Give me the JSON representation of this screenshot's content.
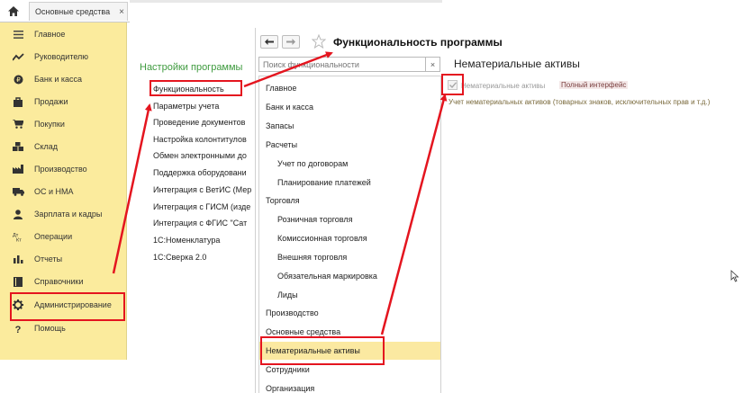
{
  "tab": {
    "title": "Основные средства",
    "close": "×"
  },
  "sidebar": {
    "items": [
      {
        "label": "Главное",
        "icon": "menu-lines-icon"
      },
      {
        "label": "Руководителю",
        "icon": "trend-icon"
      },
      {
        "label": "Банк и касса",
        "icon": "coin-icon"
      },
      {
        "label": "Продажи",
        "icon": "bag-icon"
      },
      {
        "label": "Покупки",
        "icon": "cart-icon"
      },
      {
        "label": "Склад",
        "icon": "boxes-icon"
      },
      {
        "label": "Производство",
        "icon": "factory-icon"
      },
      {
        "label": "ОС и НМА",
        "icon": "truck-icon"
      },
      {
        "label": "Зарплата и кадры",
        "icon": "person-icon"
      },
      {
        "label": "Операции",
        "icon": "dt-kt-icon"
      },
      {
        "label": "Отчеты",
        "icon": "bar-chart-icon"
      },
      {
        "label": "Справочники",
        "icon": "book-icon"
      },
      {
        "label": "Администрирование",
        "icon": "gear-icon"
      },
      {
        "label": "Помощь",
        "icon": "question-icon"
      }
    ]
  },
  "settings": {
    "title": "Настройки программы",
    "items": [
      "Функциональность",
      "Параметры учета",
      "Проведение документов",
      "Настройка колонтитулов",
      "Обмен электронными до",
      "Поддержка оборудовани",
      "Интеграция с ВетИС (Мер",
      "Интеграция с ГИСМ (изде",
      "Интеграция с ФГИС \"Сат",
      "1С:Номенклатура",
      "1С:Сверка 2.0"
    ]
  },
  "dialog": {
    "title": "Функциональность программы",
    "search_placeholder": "Поиск функциональности",
    "search_clear": "×",
    "nav": [
      {
        "label": "Главное",
        "level": 0
      },
      {
        "label": "Банк и касса",
        "level": 0
      },
      {
        "label": "Запасы",
        "level": 0
      },
      {
        "label": "Расчеты",
        "level": 0
      },
      {
        "label": "Учет по договорам",
        "level": 1
      },
      {
        "label": "Планирование платежей",
        "level": 1
      },
      {
        "label": "Торговля",
        "level": 0
      },
      {
        "label": "Розничная торговля",
        "level": 1
      },
      {
        "label": "Комиссионная торговля",
        "level": 1
      },
      {
        "label": "Внешняя торговля",
        "level": 1
      },
      {
        "label": "Обязательная маркировка",
        "level": 1
      },
      {
        "label": "Лиды",
        "level": 1
      },
      {
        "label": "Производство",
        "level": 0
      },
      {
        "label": "Основные средства",
        "level": 0
      },
      {
        "label": "Нематериальные активы",
        "level": 0,
        "selected": true
      },
      {
        "label": "Сотрудники",
        "level": 0
      },
      {
        "label": "Организация",
        "level": 0
      }
    ],
    "section_title": "Нематериальные активы",
    "checkbox_label": "Нематериальные активы",
    "checkbox_badge": "Полный интерфейс",
    "description": "Учет нематериальных активов (товарных знаков, исключительных прав и т.д.)"
  },
  "colors": {
    "sidebar_bg": "#fbeb9d",
    "selected_bg": "#fbe9a1",
    "settings_title": "#3f9b3f",
    "annotation_red": "#e4151f"
  }
}
